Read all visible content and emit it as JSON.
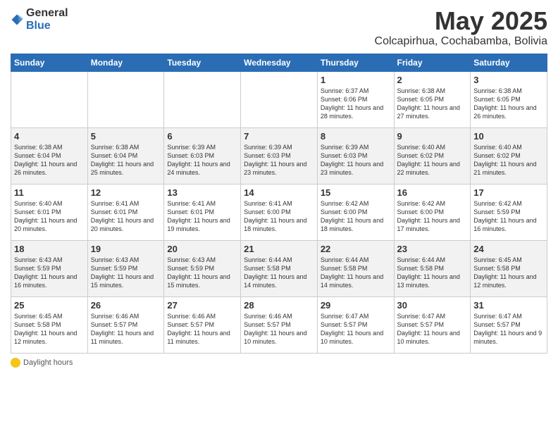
{
  "header": {
    "logo_general": "General",
    "logo_blue": "Blue",
    "month": "May 2025",
    "location": "Colcapirhua, Cochabamba, Bolivia"
  },
  "days_of_week": [
    "Sunday",
    "Monday",
    "Tuesday",
    "Wednesday",
    "Thursday",
    "Friday",
    "Saturday"
  ],
  "weeks": [
    [
      {
        "day": "",
        "sunrise": "",
        "sunset": "",
        "daylight": ""
      },
      {
        "day": "",
        "sunrise": "",
        "sunset": "",
        "daylight": ""
      },
      {
        "day": "",
        "sunrise": "",
        "sunset": "",
        "daylight": ""
      },
      {
        "day": "",
        "sunrise": "",
        "sunset": "",
        "daylight": ""
      },
      {
        "day": "1",
        "sunrise": "Sunrise: 6:37 AM",
        "sunset": "Sunset: 6:06 PM",
        "daylight": "Daylight: 11 hours and 28 minutes."
      },
      {
        "day": "2",
        "sunrise": "Sunrise: 6:38 AM",
        "sunset": "Sunset: 6:05 PM",
        "daylight": "Daylight: 11 hours and 27 minutes."
      },
      {
        "day": "3",
        "sunrise": "Sunrise: 6:38 AM",
        "sunset": "Sunset: 6:05 PM",
        "daylight": "Daylight: 11 hours and 26 minutes."
      }
    ],
    [
      {
        "day": "4",
        "sunrise": "Sunrise: 6:38 AM",
        "sunset": "Sunset: 6:04 PM",
        "daylight": "Daylight: 11 hours and 26 minutes."
      },
      {
        "day": "5",
        "sunrise": "Sunrise: 6:38 AM",
        "sunset": "Sunset: 6:04 PM",
        "daylight": "Daylight: 11 hours and 25 minutes."
      },
      {
        "day": "6",
        "sunrise": "Sunrise: 6:39 AM",
        "sunset": "Sunset: 6:03 PM",
        "daylight": "Daylight: 11 hours and 24 minutes."
      },
      {
        "day": "7",
        "sunrise": "Sunrise: 6:39 AM",
        "sunset": "Sunset: 6:03 PM",
        "daylight": "Daylight: 11 hours and 23 minutes."
      },
      {
        "day": "8",
        "sunrise": "Sunrise: 6:39 AM",
        "sunset": "Sunset: 6:03 PM",
        "daylight": "Daylight: 11 hours and 23 minutes."
      },
      {
        "day": "9",
        "sunrise": "Sunrise: 6:40 AM",
        "sunset": "Sunset: 6:02 PM",
        "daylight": "Daylight: 11 hours and 22 minutes."
      },
      {
        "day": "10",
        "sunrise": "Sunrise: 6:40 AM",
        "sunset": "Sunset: 6:02 PM",
        "daylight": "Daylight: 11 hours and 21 minutes."
      }
    ],
    [
      {
        "day": "11",
        "sunrise": "Sunrise: 6:40 AM",
        "sunset": "Sunset: 6:01 PM",
        "daylight": "Daylight: 11 hours and 20 minutes."
      },
      {
        "day": "12",
        "sunrise": "Sunrise: 6:41 AM",
        "sunset": "Sunset: 6:01 PM",
        "daylight": "Daylight: 11 hours and 20 minutes."
      },
      {
        "day": "13",
        "sunrise": "Sunrise: 6:41 AM",
        "sunset": "Sunset: 6:01 PM",
        "daylight": "Daylight: 11 hours and 19 minutes."
      },
      {
        "day": "14",
        "sunrise": "Sunrise: 6:41 AM",
        "sunset": "Sunset: 6:00 PM",
        "daylight": "Daylight: 11 hours and 18 minutes."
      },
      {
        "day": "15",
        "sunrise": "Sunrise: 6:42 AM",
        "sunset": "Sunset: 6:00 PM",
        "daylight": "Daylight: 11 hours and 18 minutes."
      },
      {
        "day": "16",
        "sunrise": "Sunrise: 6:42 AM",
        "sunset": "Sunset: 6:00 PM",
        "daylight": "Daylight: 11 hours and 17 minutes."
      },
      {
        "day": "17",
        "sunrise": "Sunrise: 6:42 AM",
        "sunset": "Sunset: 5:59 PM",
        "daylight": "Daylight: 11 hours and 16 minutes."
      }
    ],
    [
      {
        "day": "18",
        "sunrise": "Sunrise: 6:43 AM",
        "sunset": "Sunset: 5:59 PM",
        "daylight": "Daylight: 11 hours and 16 minutes."
      },
      {
        "day": "19",
        "sunrise": "Sunrise: 6:43 AM",
        "sunset": "Sunset: 5:59 PM",
        "daylight": "Daylight: 11 hours and 15 minutes."
      },
      {
        "day": "20",
        "sunrise": "Sunrise: 6:43 AM",
        "sunset": "Sunset: 5:59 PM",
        "daylight": "Daylight: 11 hours and 15 minutes."
      },
      {
        "day": "21",
        "sunrise": "Sunrise: 6:44 AM",
        "sunset": "Sunset: 5:58 PM",
        "daylight": "Daylight: 11 hours and 14 minutes."
      },
      {
        "day": "22",
        "sunrise": "Sunrise: 6:44 AM",
        "sunset": "Sunset: 5:58 PM",
        "daylight": "Daylight: 11 hours and 14 minutes."
      },
      {
        "day": "23",
        "sunrise": "Sunrise: 6:44 AM",
        "sunset": "Sunset: 5:58 PM",
        "daylight": "Daylight: 11 hours and 13 minutes."
      },
      {
        "day": "24",
        "sunrise": "Sunrise: 6:45 AM",
        "sunset": "Sunset: 5:58 PM",
        "daylight": "Daylight: 11 hours and 12 minutes."
      }
    ],
    [
      {
        "day": "25",
        "sunrise": "Sunrise: 6:45 AM",
        "sunset": "Sunset: 5:58 PM",
        "daylight": "Daylight: 11 hours and 12 minutes."
      },
      {
        "day": "26",
        "sunrise": "Sunrise: 6:46 AM",
        "sunset": "Sunset: 5:57 PM",
        "daylight": "Daylight: 11 hours and 11 minutes."
      },
      {
        "day": "27",
        "sunrise": "Sunrise: 6:46 AM",
        "sunset": "Sunset: 5:57 PM",
        "daylight": "Daylight: 11 hours and 11 minutes."
      },
      {
        "day": "28",
        "sunrise": "Sunrise: 6:46 AM",
        "sunset": "Sunset: 5:57 PM",
        "daylight": "Daylight: 11 hours and 10 minutes."
      },
      {
        "day": "29",
        "sunrise": "Sunrise: 6:47 AM",
        "sunset": "Sunset: 5:57 PM",
        "daylight": "Daylight: 11 hours and 10 minutes."
      },
      {
        "day": "30",
        "sunrise": "Sunrise: 6:47 AM",
        "sunset": "Sunset: 5:57 PM",
        "daylight": "Daylight: 11 hours and 10 minutes."
      },
      {
        "day": "31",
        "sunrise": "Sunrise: 6:47 AM",
        "sunset": "Sunset: 5:57 PM",
        "daylight": "Daylight: 11 hours and 9 minutes."
      }
    ]
  ],
  "footer": {
    "daylight_label": "Daylight hours"
  }
}
